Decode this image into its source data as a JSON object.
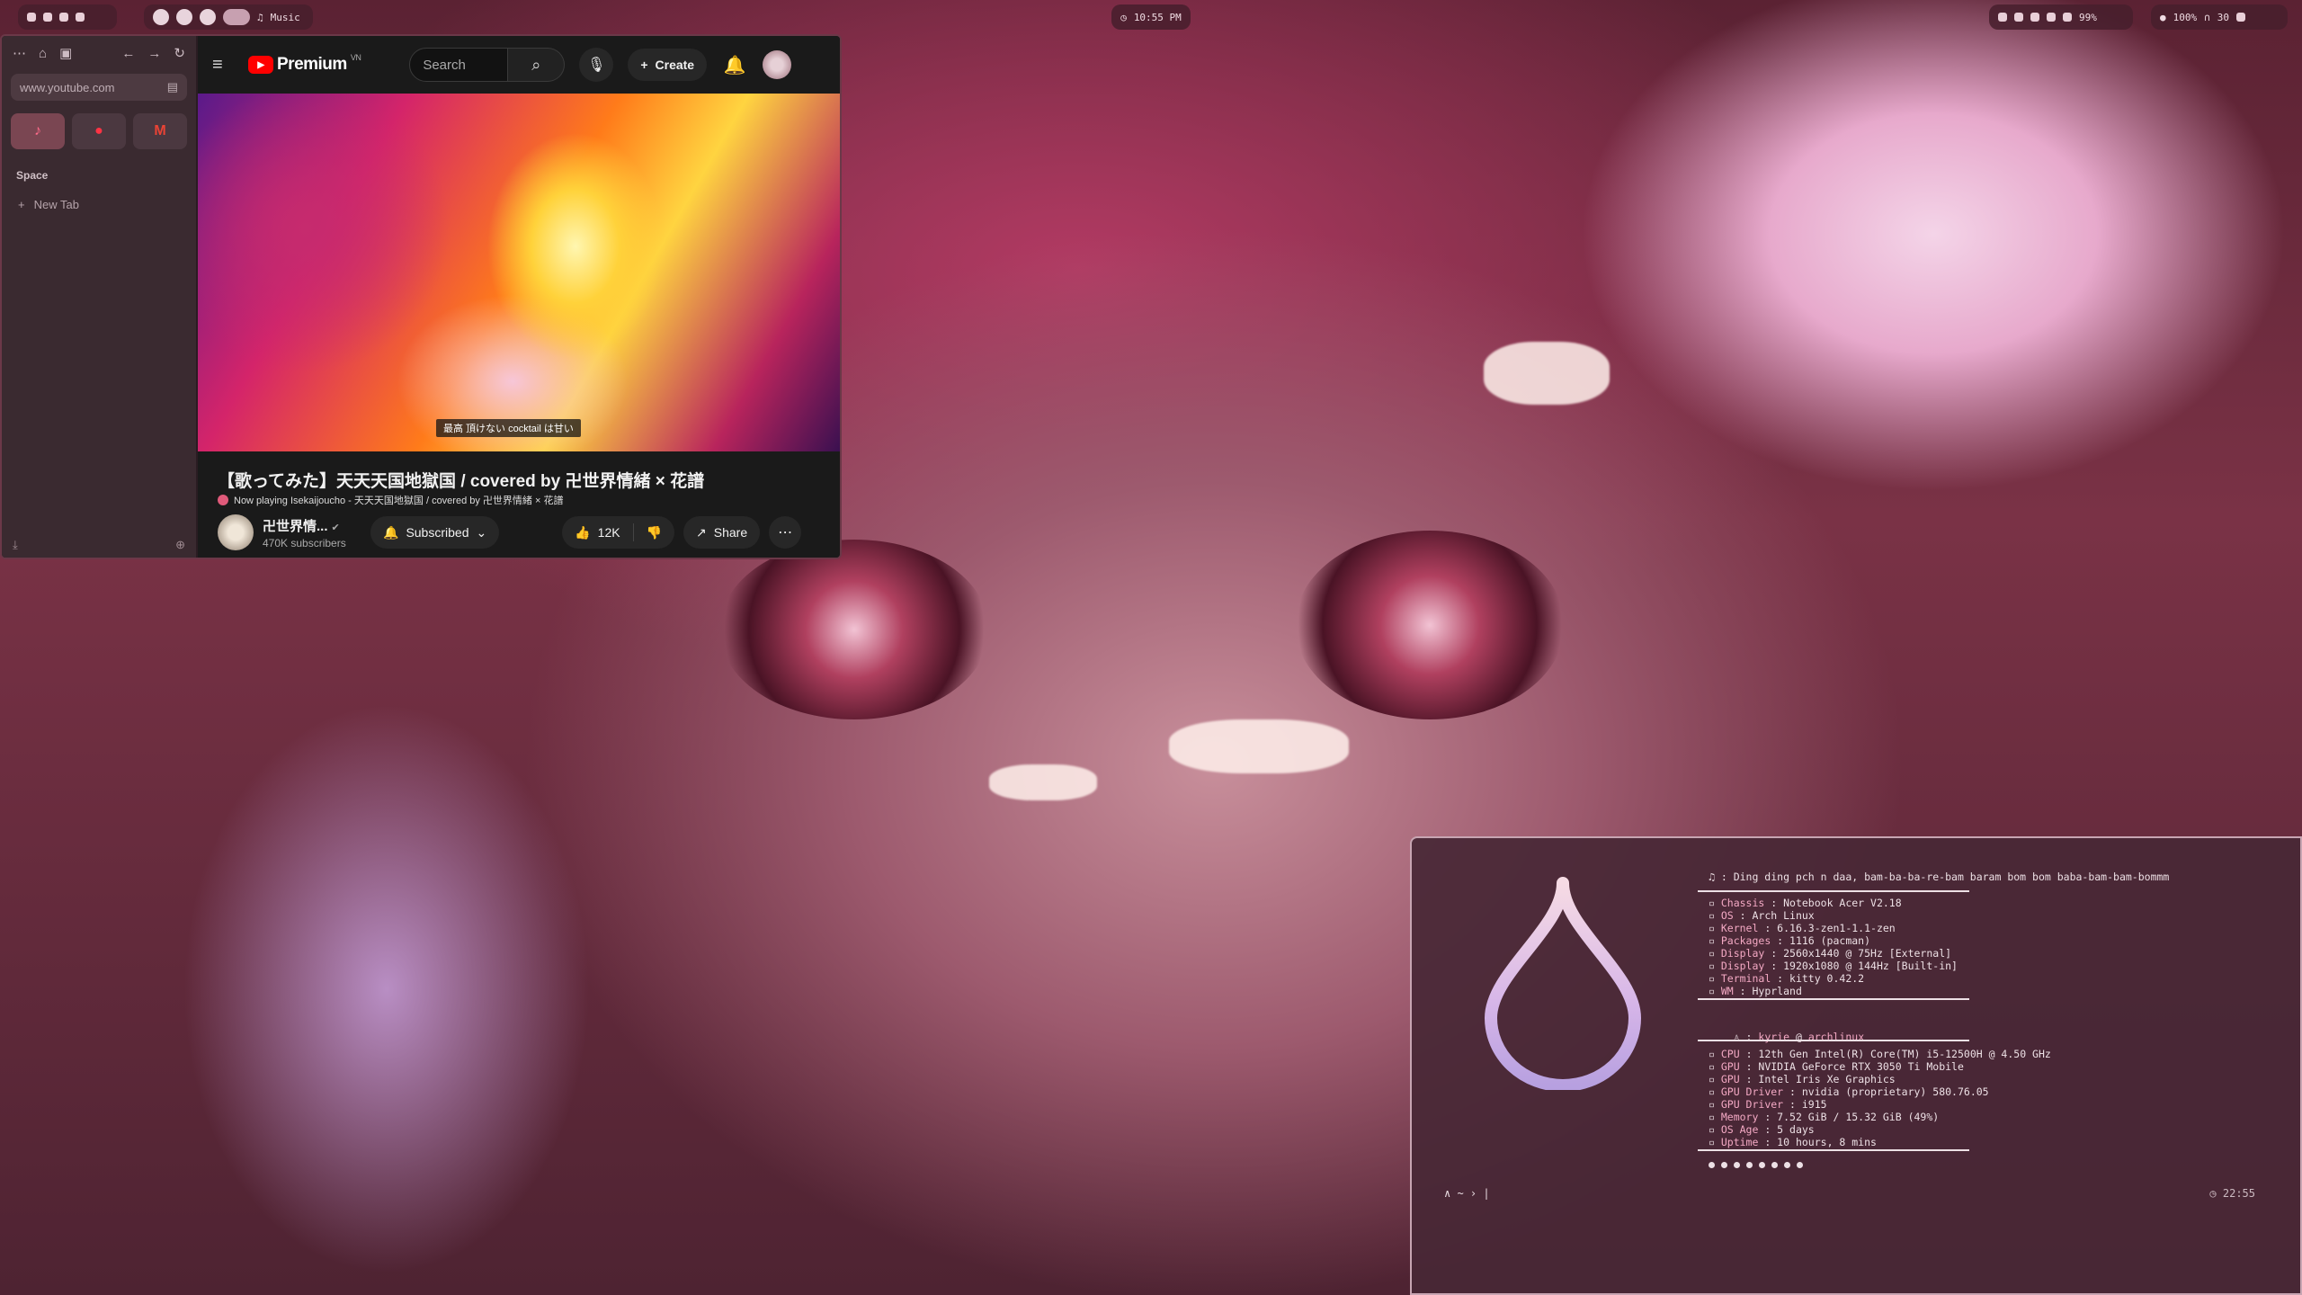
{
  "topbar": {
    "music_label": "Music",
    "clock": "10:55 PM",
    "status_right": "100%",
    "status_volume": "30",
    "status_battery": "99%"
  },
  "browser": {
    "url": "www.youtube.com",
    "space_label": "Space",
    "new_tab_label": "New Tab"
  },
  "youtube": {
    "logo": "Premium",
    "region": "VN",
    "search_placeholder": "Search",
    "create_label": "Create",
    "video_caption": "最高 頂けない cocktail は甘い",
    "video_title": "【歌ってみた】天天天国地獄国 / covered by 卍世界情緒 × 花譜",
    "now_playing": "Now playing Isekaijoucho - 天天天国地獄国 / covered by 卍世界情緒 × 花譜",
    "channel_name": "卍世界情...",
    "subscribers": "470K subscribers",
    "subscribed_label": "Subscribed",
    "likes": "12K",
    "share_label": "Share"
  },
  "terminal": {
    "quote": "♫ : Ding ding pch n daa, bam-ba-ba-re-bam baram bom bom baba-bam-bam-bommm",
    "host_lines": [
      {
        "k": "Chassis",
        "v": " : Notebook Acer V2.18"
      },
      {
        "k": "OS",
        "v": " : Arch Linux"
      },
      {
        "k": "Kernel",
        "v": " : 6.16.3-zen1-1.1-zen"
      },
      {
        "k": "Packages",
        "v": " : 1116 (pacman)"
      },
      {
        "k": "Display",
        "v": " : 2560x1440 @ 75Hz [External]"
      },
      {
        "k": "Display",
        "v": " : 1920x1080 @ 144Hz [Built-in]"
      },
      {
        "k": "Terminal",
        "v": " : kitty 0.42.2"
      },
      {
        "k": "WM",
        "v": " : Hyprland"
      }
    ],
    "user": "kyrie",
    "host": "archlinux",
    "hw_lines": [
      {
        "k": "CPU",
        "v": " : 12th Gen Intel(R) Core(TM) i5-12500H @ 4.50 GHz"
      },
      {
        "k": "GPU",
        "v": " : NVIDIA GeForce RTX 3050 Ti Mobile"
      },
      {
        "k": "GPU",
        "v": " : Intel Iris Xe Graphics"
      },
      {
        "k": "GPU Driver",
        "v": " : nvidia (proprietary) 580.76.05"
      },
      {
        "k": "GPU Driver",
        "v": " : i915"
      },
      {
        "k": "Memory",
        "v": " : 7.52 GiB / 15.32 GiB (49%)"
      },
      {
        "k": "OS Age",
        "v": " : 5 days"
      },
      {
        "k": "Uptime",
        "v": " : 10 hours, 8 mins"
      }
    ],
    "prompt": "∧ ~ › |",
    "time": "◷ 22:55"
  }
}
